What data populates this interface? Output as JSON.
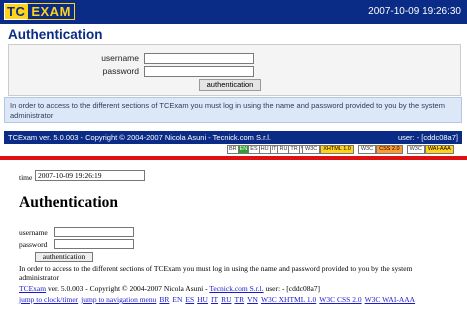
{
  "header": {
    "logo_tc": "TC",
    "logo_exam": "EXAM",
    "clock": "2007-10-09 19:26:30"
  },
  "main": {
    "title": "Authentication",
    "username_label": "username",
    "password_label": "password",
    "submit_label": "authentication",
    "info": "In order to access to the different sections of TCExam you must log in using the name and password provided to you by the system administrator"
  },
  "footer": {
    "copyright": "TCExam ver. 5.0.003 - Copyright © 2004-2007 Nicola Asuni - Tecnick.com S.r.l.",
    "user": "user: - [cddc08a7]",
    "languages": [
      "BR",
      "EN",
      "ES",
      "HU",
      "IT",
      "RU",
      "TR",
      "VN"
    ],
    "w3c": [
      {
        "tag": "W3C",
        "label": "XHTML 1.0"
      },
      {
        "tag": "W3C",
        "label": "CSS 2.0"
      },
      {
        "tag": "W3C",
        "label": "WAI-AAA"
      }
    ]
  },
  "plain": {
    "time_label": "time",
    "time_value": "2007-10-09 19:26:19",
    "title": "Authentication",
    "username_label": "username",
    "password_label": "password",
    "submit_label": "authentication",
    "info": "In order to access to the different sections of TCExam you must log in using the name and password provided to you by the system administrator",
    "footer_prefix": "TCExam",
    "footer_mid": " ver. 5.0.003 - Copyright © 2004-2007 Nicola Asuni - ",
    "footer_company": "Tecnick.com S.r.l.",
    "footer_user": " user: - [cddc08a7]",
    "jump_clock": "jump to clock/timer",
    "jump_nav": "jump to navigation menu",
    "languages": [
      "BR",
      "EN",
      "ES",
      "HU",
      "IT",
      "RU",
      "TR",
      "VN"
    ],
    "w3c_xhtml": "W3C XHTML 1.0",
    "w3c_css": "W3C CSS 2.0",
    "w3c_wai": "W3C WAI-AAA"
  }
}
